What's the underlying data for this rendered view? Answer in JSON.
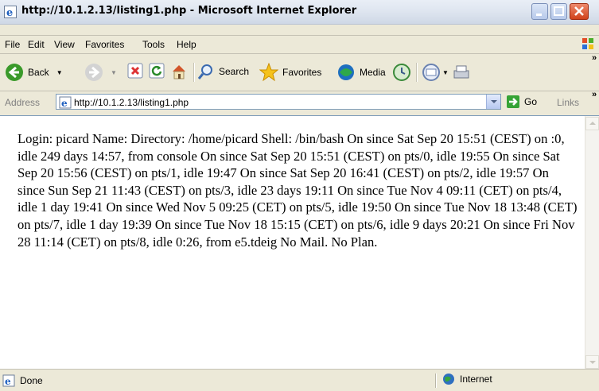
{
  "window": {
    "title": "http://10.1.2.13/listing1.php - Microsoft Internet Explorer"
  },
  "menu": {
    "file": "File",
    "edit": "Edit",
    "view": "View",
    "favorites": "Favorites",
    "tools": "Tools",
    "help": "Help"
  },
  "toolbar": {
    "back": "Back",
    "search": "Search",
    "favorites": "Favorites",
    "media": "Media"
  },
  "address": {
    "label": "Address",
    "url": "http://10.1.2.13/listing1.php",
    "go": "Go",
    "links": "Links"
  },
  "content": {
    "text": "Login: picard Name: Directory: /home/picard Shell: /bin/bash On since Sat Sep 20 15:51 (CEST) on :0, idle 249 days 14:57, from console On since Sat Sep 20 15:51 (CEST) on pts/0, idle 19:55 On since Sat Sep 20 15:56 (CEST) on pts/1, idle 19:47 On since Sat Sep 20 16:41 (CEST) on pts/2, idle 19:57 On since Sun Sep 21 11:43 (CEST) on pts/3, idle 23 days 19:11 On since Tue Nov 4 09:11 (CET) on pts/4, idle 1 day 19:41 On since Wed Nov 5 09:25 (CET) on pts/5, idle 19:50 On since Tue Nov 18 13:48 (CET) on pts/7, idle 1 day 19:39 On since Tue Nov 18 15:15 (CET) on pts/6, idle 9 days 20:21 On since Fri Nov 28 11:14 (CET) on pts/8, idle 0:26, from e5.tdeig No Mail. No Plan."
  },
  "status": {
    "text": "Done",
    "zone": "Internet"
  },
  "icons": [
    "ie-icon",
    "minimize-icon",
    "maximize-icon",
    "close-icon",
    "windows-flag-icon",
    "back-icon",
    "forward-icon",
    "stop-icon",
    "refresh-icon",
    "home-icon",
    "search-icon",
    "favorites-star-icon",
    "media-icon",
    "history-icon",
    "mail-icon",
    "print-icon",
    "page-icon",
    "go-arrow-icon",
    "globe-icon"
  ],
  "colors": {
    "accent": "#2f8a2f",
    "title_close": "#d0421b",
    "addr_border": "#7f9db9"
  }
}
